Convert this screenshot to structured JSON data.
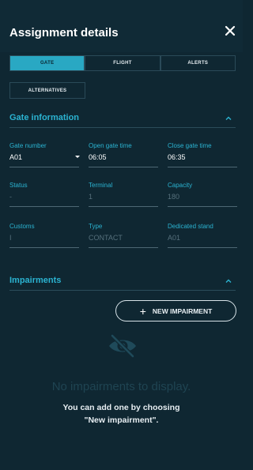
{
  "header": {
    "title": "Assignment details",
    "close_icon": "close-icon"
  },
  "tabs": [
    {
      "label": "GATE",
      "active": true
    },
    {
      "label": "FLIGHT",
      "active": false
    },
    {
      "label": "ALERTS",
      "active": false
    },
    {
      "label": "ALTERNATIVES",
      "active": false
    }
  ],
  "gate_info": {
    "title": "Gate information",
    "fields": {
      "gate_number": {
        "label": "Gate number",
        "value": "A01"
      },
      "open_gate_time": {
        "label": "Open gate time",
        "value": "06:05"
      },
      "close_gate_time": {
        "label": "Close gate time",
        "value": "06:35"
      },
      "status": {
        "label": "Status",
        "value": "-"
      },
      "terminal": {
        "label": "Terminal",
        "value": "1"
      },
      "capacity": {
        "label": "Capacity",
        "value": "180"
      },
      "customs": {
        "label": "Customs",
        "value": "I"
      },
      "type": {
        "label": "Type",
        "value": "CONTACT"
      },
      "dedicated_stand": {
        "label": "Dedicated stand",
        "value": "A01"
      }
    }
  },
  "impairments": {
    "title": "Impairments",
    "new_button": "NEW IMPAIRMENT",
    "empty_title": "No impairments to display.",
    "empty_line1": "You can add one by choosing",
    "empty_line2": "\"New impairment\"."
  },
  "colors": {
    "background": "#0f2732",
    "accent": "#2bb3d1",
    "active_tab": "#29a8c3"
  }
}
